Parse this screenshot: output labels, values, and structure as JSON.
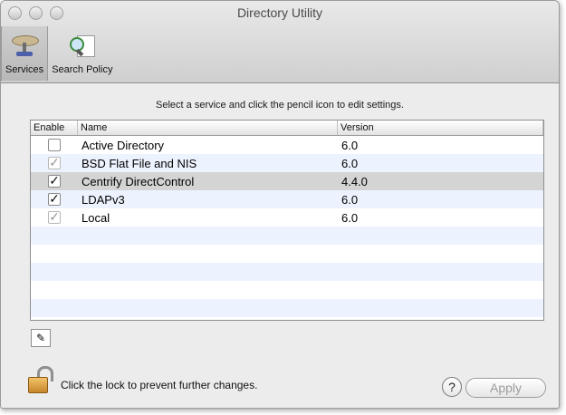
{
  "window": {
    "title": "Directory Utility"
  },
  "toolbar": {
    "items": [
      {
        "label": "Services",
        "icon": "services-icon",
        "selected": true
      },
      {
        "label": "Search Policy",
        "icon": "search-policy-icon",
        "selected": false
      }
    ]
  },
  "services": {
    "instruction": "Select a service and click the pencil icon to edit settings.",
    "columns": [
      "Enable",
      "Name",
      "Version"
    ],
    "rows": [
      {
        "enabled": false,
        "dimmed": false,
        "name": "Active Directory",
        "version": "6.0"
      },
      {
        "enabled": true,
        "dimmed": true,
        "name": "BSD Flat File and NIS",
        "version": "6.0"
      },
      {
        "enabled": true,
        "dimmed": false,
        "name": "Centrify DirectControl",
        "version": "4.4.0",
        "selected": true
      },
      {
        "enabled": true,
        "dimmed": false,
        "name": "LDAPv3",
        "version": "6.0"
      },
      {
        "enabled": true,
        "dimmed": true,
        "name": "Local",
        "version": "6.0"
      }
    ]
  },
  "footer": {
    "lock_text": "Click the lock to prevent further changes.",
    "help_label": "?",
    "apply_label": "Apply"
  }
}
